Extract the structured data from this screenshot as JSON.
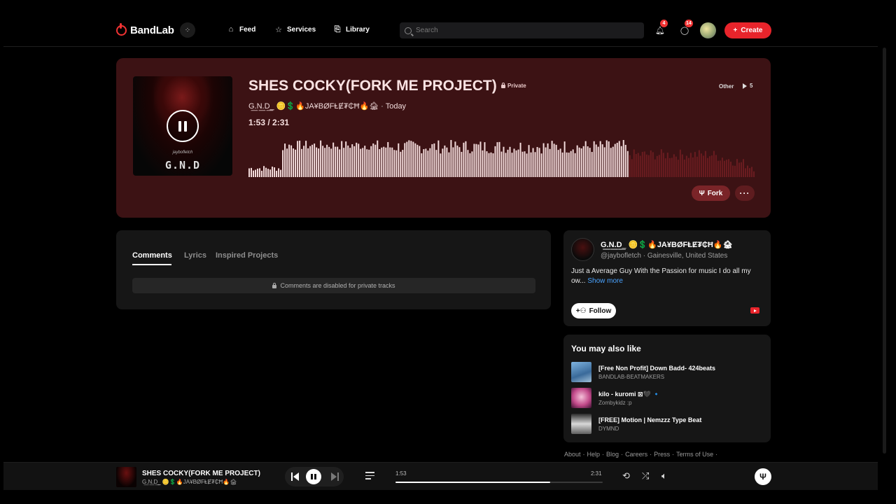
{
  "brand": {
    "name": "BandLab",
    "accent": "#e8242b"
  },
  "nav": {
    "items": [
      {
        "label": "Feed",
        "icon": "home-icon"
      },
      {
        "label": "Services",
        "icon": "star-icon"
      },
      {
        "label": "Library",
        "icon": "library-icon"
      }
    ],
    "search_placeholder": "Search",
    "notifications_count": "4",
    "messages_count": "14",
    "create_label": "Create"
  },
  "track": {
    "title": "SHES COCKY(FORK ME PROJECT)",
    "visibility": "Private",
    "genre": "Other",
    "plays": "5",
    "artist": "G͟.N͟.D͟_ 🪙💲🔥JA¥BØFⱠɆ₮₵Ħ🔥🏚",
    "date": "Today",
    "current_time": "1:53",
    "duration": "2:31",
    "progress_fraction": 0.748,
    "cover_subtext": "jaybofletch",
    "cover_logo": "G.N.D",
    "fork_label": "Fork",
    "more_label": "···"
  },
  "comments": {
    "tabs": [
      "Comments",
      "Lyrics",
      "Inspired Projects"
    ],
    "active_tab": "Comments",
    "disabled_message": "Comments are disabled for private tracks"
  },
  "profile": {
    "name": "G͟.N͟.D͟_ 🪙💲🔥JA¥BØFⱠɆ₮₵Ħ🔥🏚",
    "handle": "@jaybofletch",
    "location": "Gainesville, United States",
    "bio": "Just a Average Guy With the Passion for music I do all my ow...",
    "show_more": "Show more",
    "follow_label": "Follow"
  },
  "recommendations": {
    "title": "You may also like",
    "items": [
      {
        "title": "[Free Non Profit] Down Badd- 424beats",
        "artist": "BANDLAB-BEATMAKERS"
      },
      {
        "title": "kilo - kuromi ⊠🖤 🔹",
        "artist": "Zombykidz :p"
      },
      {
        "title": "[FREE] Motion | Nemzzz Type Beat",
        "artist": "DYMND"
      }
    ]
  },
  "footer_links": [
    "About",
    "Help",
    "Blog",
    "Careers",
    "Press",
    "Terms of Use"
  ],
  "player": {
    "title": "SHES COCKY(FORK ME PROJECT)",
    "artist": "G͟.N͟.D͟_ 🪙💲🔥JA¥BØFⱠɆ₮₵Ħ🔥🏚",
    "current_time": "1:53",
    "duration": "2:31"
  }
}
